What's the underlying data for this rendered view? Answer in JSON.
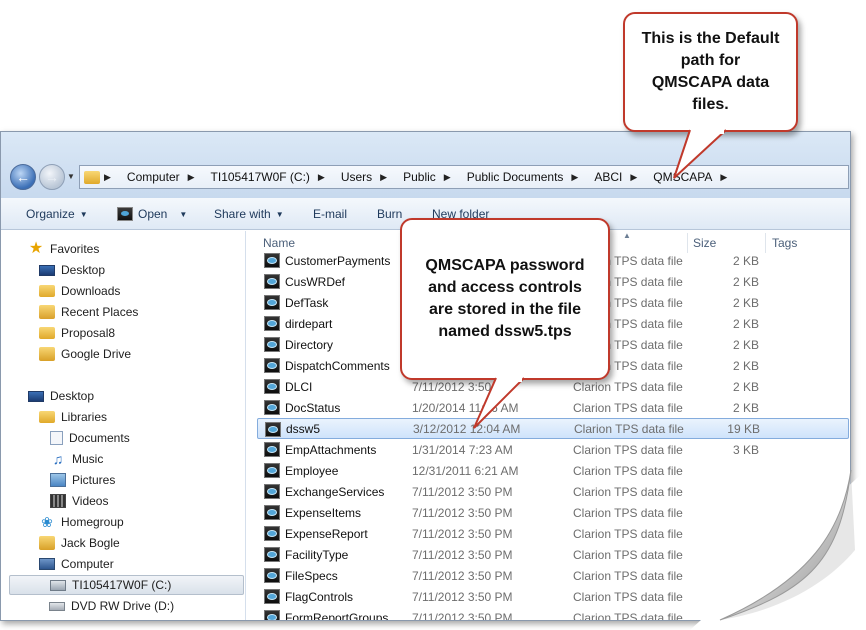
{
  "address": {
    "crumbs": [
      "Computer",
      "TI105417W0F (C:)",
      "Users",
      "Public",
      "Public Documents",
      "ABCI",
      "QMSCAPA"
    ]
  },
  "toolbar": {
    "organize": "Organize",
    "open": "Open",
    "share_with": "Share with",
    "email": "E-mail",
    "burn": "Burn",
    "new_folder": "New folder"
  },
  "nav": {
    "favorites": "Favorites",
    "desktop_fav": "Desktop",
    "downloads": "Downloads",
    "recent_places": "Recent Places",
    "proposal8": "Proposal8",
    "google_drive": "Google Drive",
    "desktop": "Desktop",
    "libraries": "Libraries",
    "documents": "Documents",
    "music": "Music",
    "pictures": "Pictures",
    "videos": "Videos",
    "homegroup": "Homegroup",
    "user": "Jack Bogle",
    "computer": "Computer",
    "drive_c": "TI105417W0F (C:)",
    "drive_d": "DVD RW Drive (D:)"
  },
  "columns": {
    "name": "Name",
    "size": "Size",
    "tags": "Tags"
  },
  "files": [
    {
      "name": "CustomerPayments",
      "date": "",
      "type": "Clarion TPS data file",
      "size": "2 KB"
    },
    {
      "name": "CusWRDef",
      "date": "",
      "type": "Clarion TPS data file",
      "size": "2 KB"
    },
    {
      "name": "DefTask",
      "date": "",
      "type": "Clarion TPS data file",
      "size": "2 KB"
    },
    {
      "name": "dirdepart",
      "date": "",
      "type": "Clarion TPS data file",
      "size": "2 KB"
    },
    {
      "name": "Directory",
      "date": "",
      "type": "Clarion TPS data file",
      "size": "2 KB"
    },
    {
      "name": "DispatchComments",
      "date": "",
      "type": "Clarion TPS data file",
      "size": "2 KB"
    },
    {
      "name": "DLCI",
      "date": "7/11/2012 3:50",
      "type": "Clarion TPS data file",
      "size": "2 KB"
    },
    {
      "name": "DocStatus",
      "date": "1/20/2014 11:26 AM",
      "type": "Clarion TPS data file",
      "size": "2 KB"
    },
    {
      "name": "dssw5",
      "date": "3/12/2012 12:04 AM",
      "type": "Clarion TPS data file",
      "size": "19 KB"
    },
    {
      "name": "EmpAttachments",
      "date": "1/31/2014 7:23 AM",
      "type": "Clarion TPS data file",
      "size": "3 KB"
    },
    {
      "name": "Employee",
      "date": "12/31/2011 6:21 AM",
      "type": "Clarion TPS data file",
      "size": ""
    },
    {
      "name": "ExchangeServices",
      "date": "7/11/2012 3:50 PM",
      "type": "Clarion TPS data file",
      "size": ""
    },
    {
      "name": "ExpenseItems",
      "date": "7/11/2012 3:50 PM",
      "type": "Clarion TPS data file",
      "size": ""
    },
    {
      "name": "ExpenseReport",
      "date": "7/11/2012 3:50 PM",
      "type": "Clarion TPS data file",
      "size": ""
    },
    {
      "name": "FacilityType",
      "date": "7/11/2012 3:50 PM",
      "type": "Clarion TPS data file",
      "size": ""
    },
    {
      "name": "FileSpecs",
      "date": "7/11/2012 3:50 PM",
      "type": "Clarion TPS data file",
      "size": ""
    },
    {
      "name": "FlagControls",
      "date": "7/11/2012 3:50 PM",
      "type": "Clarion TPS data file",
      "size": ""
    },
    {
      "name": "FormReportGroups",
      "date": "7/11/2012 3:50 PM",
      "type": "Clarion TPS data file",
      "size": ""
    }
  ],
  "callouts": {
    "default_path": "This is the Default path for QMSCAPA data files.",
    "password": "QMSCAPA password and access controls are stored in the file named dssw5.tps"
  }
}
